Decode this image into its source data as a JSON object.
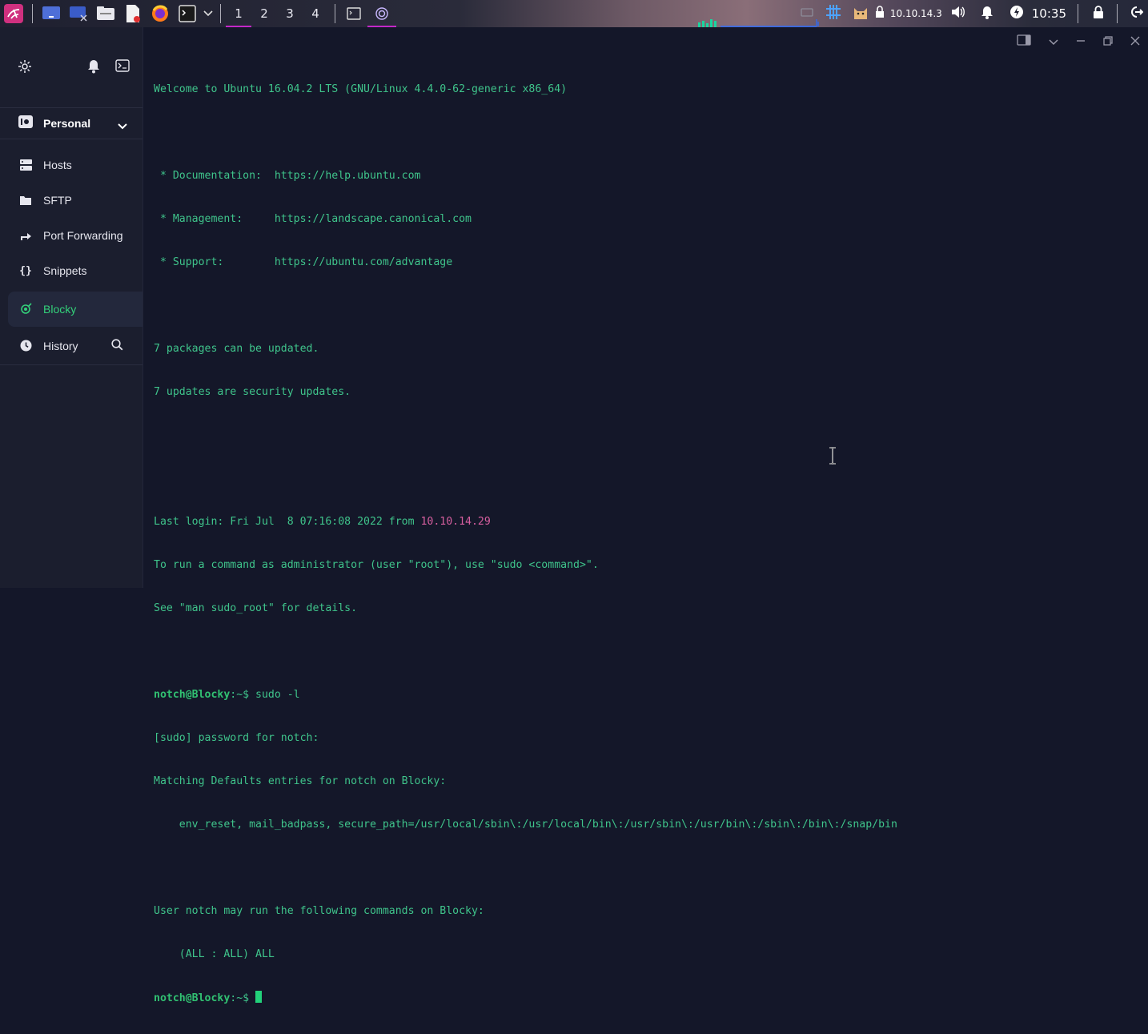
{
  "topbar": {
    "workspaces": [
      "1",
      "2",
      "3",
      "4"
    ],
    "active_workspace": "1",
    "ip_address": "10.10.14.3",
    "clock": "10:35",
    "launcher_icons": [
      "kali-menu-icon",
      "desktop-icon",
      "vm-icon",
      "file-manager-icon",
      "text-editor-icon",
      "firefox-icon",
      "terminal-icon"
    ],
    "tray_icons": [
      "display-icon",
      "hashtag-icon",
      "cat-icon",
      "vpn-lock-icon",
      "volume-icon",
      "bell-icon",
      "power-icon",
      "lock-icon",
      "logout-icon"
    ]
  },
  "sidebar": {
    "vault_label": "Personal",
    "items": [
      {
        "label": "Hosts",
        "icon": "hosts-icon"
      },
      {
        "label": "SFTP",
        "icon": "folder-icon"
      },
      {
        "label": "Port Forwarding",
        "icon": "port-forward-icon"
      },
      {
        "label": "Snippets",
        "icon": "snippets-icon"
      },
      {
        "label": "Blocky",
        "icon": "host-session-icon"
      },
      {
        "label": "History",
        "icon": "history-icon"
      }
    ],
    "active_item": "Blocky"
  },
  "terminal": {
    "lines": [
      "Welcome to Ubuntu 16.04.2 LTS (GNU/Linux 4.4.0-62-generic x86_64)",
      "",
      " * Documentation:  https://help.ubuntu.com",
      " * Management:     https://landscape.canonical.com",
      " * Support:        https://ubuntu.com/advantage",
      "",
      "7 packages can be updated.",
      "7 updates are security updates.",
      "",
      "",
      "Last login: Fri Jul  8 07:16:08 2022 from ",
      "To run a command as administrator (user \"root\"), use \"sudo <command>\".",
      "See \"man sudo_root\" for details.",
      "",
      "",
      "[sudo] password for notch:",
      "Matching Defaults entries for notch on Blocky:",
      "    env_reset, mail_badpass, secure_path=/usr/local/sbin\\:/usr/local/bin\\:/usr/sbin\\:/usr/bin\\:/sbin\\:/bin\\:/snap/bin",
      "",
      "User notch may run the following commands on Blocky:",
      "    (ALL : ALL) ALL",
      ""
    ],
    "last_login_ip": "10.10.14.29",
    "prompt": "notch@Blocky",
    "prompt_suffix": ":~$ ",
    "command": "sudo -l"
  },
  "colors": {
    "terminal_bg": "#141729",
    "terminal_text": "#3fc48b",
    "prompt": "#31c172",
    "ip_highlight": "#d75fa0",
    "sidebar_bg": "#1b1e2e",
    "accent": "#33d17a",
    "workspace_indicator": "#c428c8"
  }
}
